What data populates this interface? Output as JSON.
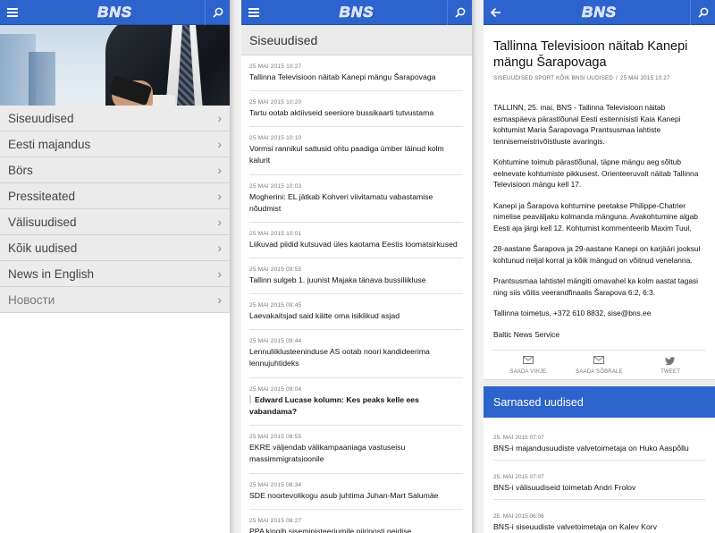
{
  "brand": {
    "logo_text": "BNS",
    "accent": "#2d63cc"
  },
  "left_panel": {
    "menu_icon": "hamburger-icon",
    "search_icon": "search-icon",
    "nav": [
      {
        "label": "Siseuudised"
      },
      {
        "label": "Eesti majandus"
      },
      {
        "label": "Börs"
      },
      {
        "label": "Pressiteated"
      },
      {
        "label": "Välisuudised"
      },
      {
        "label": "Kõik uudised"
      },
      {
        "label": "News in English"
      },
      {
        "label": "Новости"
      }
    ]
  },
  "middle_panel": {
    "section_title": "Siseuudised",
    "items": [
      {
        "date": "25 MAI 2015 10:27",
        "headline": "Tallinna Televisioon näitab Kanepi mängu Šarapovaga"
      },
      {
        "date": "25 MAI 2015 10:20",
        "headline": "Tartu ootab aktiivseid seeniore bussikaarti tutvustama"
      },
      {
        "date": "25 MAI 2015 10:10",
        "headline": "Vormsi rannikul sattusid ohtu paadiga ümber läinud kolm kalurit"
      },
      {
        "date": "25 MAI 2015 10:03",
        "headline": "Mogherini: EL jätkab Kohveri viivitamatu vabastamise nõudmist"
      },
      {
        "date": "25 MAI 2015 10:01",
        "headline": "Liikuvad piidid kutsuvad üles kaotama Eestis loomatsirkused"
      },
      {
        "date": "25 MAI 2015 09:55",
        "headline": "Tallinn sulgeb 1. juunist Majaka tänava bussiliikluse"
      },
      {
        "date": "25 MAI 2015 09:45",
        "headline": "Laevakaitsjad said kätte oma isiklikud asjad"
      },
      {
        "date": "25 MAI 2015 09:44",
        "headline": "Lennuliiklusteeninduse AS ootab noori kandideerima lennujuhtideks"
      },
      {
        "date": "25 MAI 2015 09:04",
        "headline": "Edward Lucase kolumn: Kes peaks kelle ees vabandama?",
        "bold": true
      },
      {
        "date": "25 MAI 2015 08:55",
        "headline": "EKRE väljendab välikampaaniaga vastuseisu massimmigratsioonile"
      },
      {
        "date": "25 MAI 2015 08:34",
        "headline": "SDE noortevolikogu asub juhtima Juhan-Mart Salumäe"
      },
      {
        "date": "25 MAI 2015 08:27",
        "headline": "PPA kingib siseministeeriumile piiriposti neidise"
      }
    ]
  },
  "right_panel": {
    "back_icon": "back-arrow-icon",
    "search_icon": "search-icon",
    "article": {
      "title": "Tallinna Televisioon näitab Kanepi mängu Šarapovaga",
      "crumbs": "SISEUUDISED SPORT KÕIK BNSI UUDISED",
      "crumb_sep": "/",
      "date": "25 MAI 2015 10:27",
      "paragraphs": [
        "TALLINN, 25. mai, BNS - Tallinna Televisioon näitab esmaspäeva pärastlõunal Eesti esitennisisti Kaia Kanepi kohtumist Maria Šarapovaga Prantsusmaa lahtiste tennisemeistrivõistluste avaringis.",
        "Kohtumine toimub pärastlõunal, täpne mängu aeg sõltub eelnevate kohtumiste pikkusest. Orienteeruvalt näitab Tallinna Televisioon mängu kell 17.",
        "Kanepi ja Šarapova kohtumine peetakse Philippe-Chatrier nimelise peaväljaku kolmanda mänguna. Avakohtumine algab Eesti aja järgi kell 12. Kohtumist kommenteerib Maxim Tuul.",
        "28-aastane Šarapova ja 29-aastane Kanepi on karjääri jooksul kohtunud neljal korral ja kõik mängud on võitnud venelanna.",
        "Prantsusmaa lahtistel mängiti omavahel ka kolm aastat tagasi ning siis võitis veerandfinaalis Šarapova 6:2, 6:3.",
        "Tallinna toimetus, +372 610 8832, sise@bns.ee",
        "Baltic News Service"
      ]
    },
    "share": [
      {
        "label": "SAADA VIHJE",
        "icon": "mail-icon"
      },
      {
        "label": "SAADA SÕBRALE",
        "icon": "mail-icon"
      },
      {
        "label": "TWEET",
        "icon": "twitter-icon"
      }
    ],
    "related_title": "Sarnased uudised",
    "related": [
      {
        "date": "25. MAI 2015 07:07",
        "headline": "BNS-i majandusuudiste valvetoimetaja on Huko Aaspõllu"
      },
      {
        "date": "25. MAI 2015 07:07",
        "headline": "BNS-i välisuudiseid toimetab Andri Frolov"
      },
      {
        "date": "25. MAI 2015 06:06",
        "headline": "BNS-i siseuudiste valvetoimetaja on Kalev Korv"
      }
    ]
  }
}
